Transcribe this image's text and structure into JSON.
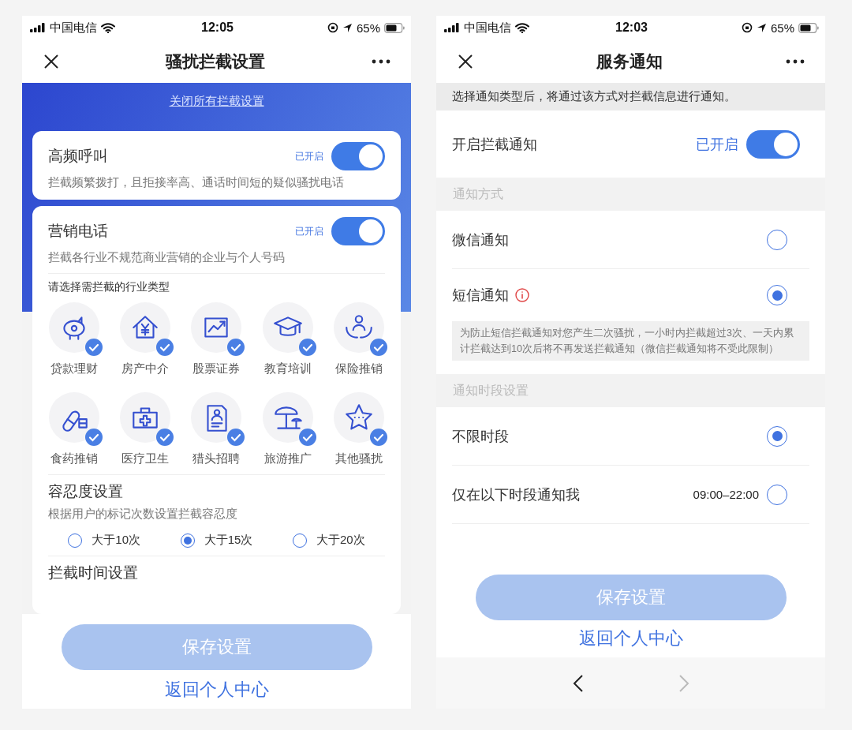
{
  "harassment_settings": {
    "status_bar": {
      "carrier": "中国电信",
      "time": "12:05",
      "battery": "65%"
    },
    "nav": {
      "title": "骚扰拦截设置"
    },
    "close_all_link": "关闭所有拦截设置",
    "cards": [
      {
        "title": "高频呼叫",
        "status": "已开启",
        "on": true,
        "description": "拦截频繁拨打，且拒接率高、通话时间短的疑似骚扰电话"
      },
      {
        "title": "营销电话",
        "status": "已开启",
        "on": true,
        "description": "拦截各行业不规范商业营销的企业与个人号码"
      }
    ],
    "industry": {
      "label": "请选择需拦截的行业类型",
      "items": [
        {
          "label": "贷款理财",
          "checked": true
        },
        {
          "label": "房产中介",
          "checked": true
        },
        {
          "label": "股票证券",
          "checked": true
        },
        {
          "label": "教育培训",
          "checked": true
        },
        {
          "label": "保险推销",
          "checked": true
        },
        {
          "label": "食药推销",
          "checked": true
        },
        {
          "label": "医疗卫生",
          "checked": true
        },
        {
          "label": "猎头招聘",
          "checked": true
        },
        {
          "label": "旅游推广",
          "checked": true
        },
        {
          "label": "其他骚扰",
          "checked": true
        }
      ]
    },
    "tolerance": {
      "title": "容忍度设置",
      "description": "根据用户的标记次数设置拦截容忍度",
      "options": [
        {
          "label": "大于10次",
          "selected": false
        },
        {
          "label": "大于15次",
          "selected": true
        },
        {
          "label": "大于20次",
          "selected": false
        }
      ]
    },
    "time_setting": {
      "title": "拦截时间设置"
    },
    "save_button": {
      "label": "保存设置",
      "disabled": true
    },
    "back_link": "返回个人中心"
  },
  "service_notification": {
    "status_bar": {
      "carrier": "中国电信",
      "time": "12:03",
      "battery": "65%"
    },
    "nav": {
      "title": "服务通知"
    },
    "info": "选择通知类型后，将通过该方式对拦截信息进行通知。",
    "toggle": {
      "label": "开启拦截通知",
      "status": "已开启",
      "on": true
    },
    "sections": [
      {
        "header": "通知方式",
        "options": [
          {
            "label": "微信通知",
            "selected": false
          },
          {
            "label": "短信通知",
            "selected": true,
            "info": true,
            "note": "为防止短信拦截通知对您产生二次骚扰，一小时内拦截超过3次、一天内累计拦截达到10次后将不再发送拦截通知（微信拦截通知将不受此限制）"
          }
        ]
      },
      {
        "header": "通知时段设置",
        "options": [
          {
            "label": "不限时段",
            "selected": true
          },
          {
            "label": "仅在以下时段通知我",
            "value": "09:00–22:00",
            "selected": false
          }
        ]
      }
    ],
    "save_button": {
      "label": "保存设置",
      "disabled": true
    },
    "back_link": "返回个人中心",
    "browser_nav": {
      "back_enabled": true,
      "forward_enabled": false
    }
  }
}
